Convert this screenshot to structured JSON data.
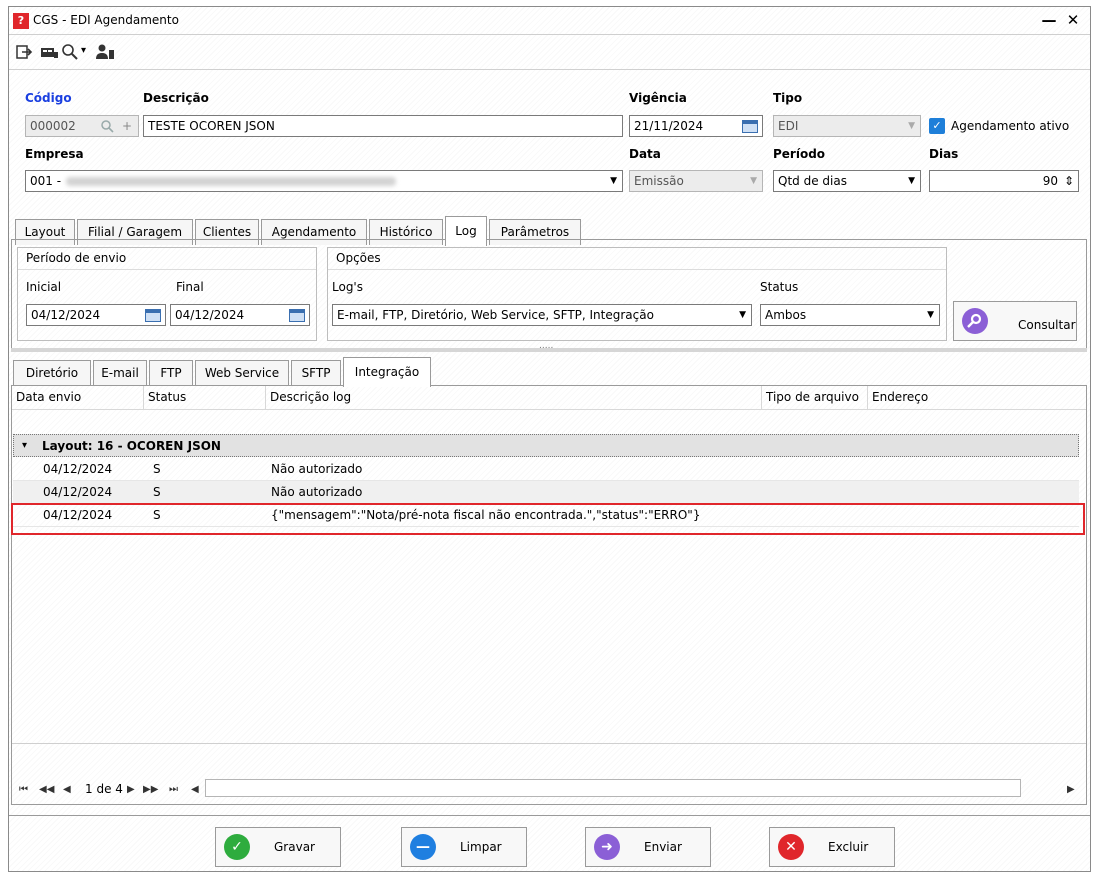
{
  "window": {
    "title": "CGS - EDI Agendamento",
    "minimize": "—",
    "close": "✕"
  },
  "toolbar": {
    "icons": [
      "exit-icon",
      "screen-icon",
      "search-icon",
      "user-icon"
    ],
    "search_arrow": "▾"
  },
  "form": {
    "codigo": {
      "label": "Código",
      "value": "000002",
      "plus": "+"
    },
    "descricao": {
      "label": "Descrição",
      "value": "TESTE OCOREN JSON"
    },
    "vigencia": {
      "label": "Vigência",
      "value": "21/11/2024"
    },
    "tipo": {
      "label": "Tipo",
      "value": "EDI"
    },
    "agendamento_ativo": {
      "label": "Agendamento ativo",
      "checked": true,
      "mark": "✓"
    },
    "empresa": {
      "label": "Empresa",
      "value": "001 -"
    },
    "data": {
      "label": "Data",
      "value": "Emissão"
    },
    "periodo": {
      "label": "Período",
      "value": "Qtd de dias"
    },
    "dias": {
      "label": "Dias",
      "value": "90",
      "spin": "⇕"
    }
  },
  "tabs": [
    "Layout",
    "Filial / Garagem",
    "Clientes",
    "Agendamento",
    "Histórico",
    "Log",
    "Parâmetros"
  ],
  "active_tab": "Log",
  "log_panel": {
    "periodo_envio": {
      "title": "Período de envio",
      "inicial_label": "Inicial",
      "inicial_value": "04/12/2024",
      "final_label": "Final",
      "final_value": "04/12/2024"
    },
    "opcoes": {
      "title": "Opções",
      "logs_label": "Log's",
      "logs_value": "E-mail, FTP, Diretório, Web Service, SFTP, Integração",
      "status_label": "Status",
      "status_value": "Ambos"
    },
    "consultar_label": "Consultar",
    "splitter": "....."
  },
  "subtabs": [
    "Diretório",
    "E-mail",
    "FTP",
    "Web Service",
    "SFTP",
    "Integração"
  ],
  "active_subtab": "Integração",
  "grid": {
    "columns": [
      "Data envio",
      "Status",
      "Descrição log",
      "Tipo de arquivo",
      "Endereço"
    ],
    "group_label": "Layout: 16 - OCOREN JSON",
    "group_arrow": "▾",
    "rows": [
      {
        "data_envio": "04/12/2024",
        "status": "S",
        "descricao": "Não autorizado"
      },
      {
        "data_envio": "04/12/2024",
        "status": "S",
        "descricao": "Não autorizado"
      },
      {
        "data_envio": "04/12/2024",
        "status": "S",
        "descricao": "{\"mensagem\":\"Nota/pré-nota fiscal não encontrada.\",\"status\":\"ERRO\"}"
      }
    ],
    "highlight_color": "#e0262b"
  },
  "pager": {
    "first": "⏮",
    "prev_page": "◀◀",
    "prev": "◀",
    "page_text": "1 de 4",
    "next": "▶",
    "next_page": "▶▶",
    "last": "⏭",
    "prev2": "◀",
    "scroll_right": "▶"
  },
  "buttons": [
    {
      "label": "Gravar",
      "color": "#2eac3e",
      "glyph": "✓"
    },
    {
      "label": "Limpar",
      "color": "#1f7fe0",
      "glyph": "—"
    },
    {
      "label": "Enviar",
      "color": "#8b5fd6",
      "glyph": "➜"
    },
    {
      "label": "Excluir",
      "color": "#e0262b",
      "glyph": "✕"
    }
  ]
}
